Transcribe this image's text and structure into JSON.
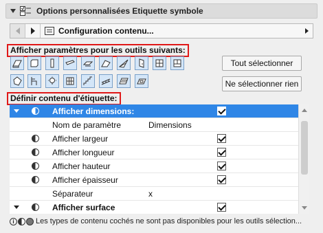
{
  "panel": {
    "title": "Options personnalisées Etiquette symbole"
  },
  "navbar": {
    "label": "Configuration contenu..."
  },
  "tools_section": {
    "label": "Afficher paramètres pour les outils suivants:",
    "select_all_label": "Tout sélectionner",
    "select_none_label": "Ne sélectionner rien",
    "row1_icons": [
      "slab-tool-icon",
      "wall-tool-icon",
      "column-tool-icon",
      "beam-tool-icon",
      "roof-tool-icon",
      "shell-tool-icon",
      "mesh-tool-icon",
      "door-tool-icon",
      "window-tool-icon",
      "zone-tool-icon"
    ],
    "row2_icons": [
      "morph-tool-icon",
      "object-tool-icon",
      "lamp-tool-icon",
      "curtain-wall-tool-icon",
      "stair-tool-icon",
      "railing-tool-icon",
      "fill-tool-icon",
      "skylight-tool-icon"
    ]
  },
  "content_section": {
    "label": "Définir contenu d'étiquette:"
  },
  "rows": [
    {
      "label": "Afficher dimensions:",
      "value": "",
      "checked": true,
      "bold": true,
      "selected": true,
      "tri": true,
      "half": true
    },
    {
      "label": "Nom de paramètre",
      "value": "Dimensions",
      "checked": false,
      "bold": false,
      "selected": false,
      "tri": false,
      "half": false
    },
    {
      "label": "Afficher largeur",
      "value": "",
      "checked": true,
      "bold": false,
      "selected": false,
      "tri": false,
      "half": true
    },
    {
      "label": "Afficher longueur",
      "value": "",
      "checked": true,
      "bold": false,
      "selected": false,
      "tri": false,
      "half": true
    },
    {
      "label": "Afficher hauteur",
      "value": "",
      "checked": true,
      "bold": false,
      "selected": false,
      "tri": false,
      "half": true
    },
    {
      "label": "Afficher épaisseur",
      "value": "",
      "checked": true,
      "bold": false,
      "selected": false,
      "tri": false,
      "half": true
    },
    {
      "label": "Séparateur",
      "value": "x",
      "checked": false,
      "bold": false,
      "selected": false,
      "tri": false,
      "half": false
    },
    {
      "label": "Afficher surface",
      "value": "",
      "checked": true,
      "bold": true,
      "selected": false,
      "tri": true,
      "half": true
    }
  ],
  "footer": {
    "text": "Les types de contenu cochés ne sont pas disponibles pour les outils sélection..."
  },
  "colors": {
    "selection": "#2f86e6",
    "highlight_border": "#e01818",
    "tool_button_bg": "#d4e6f8"
  }
}
